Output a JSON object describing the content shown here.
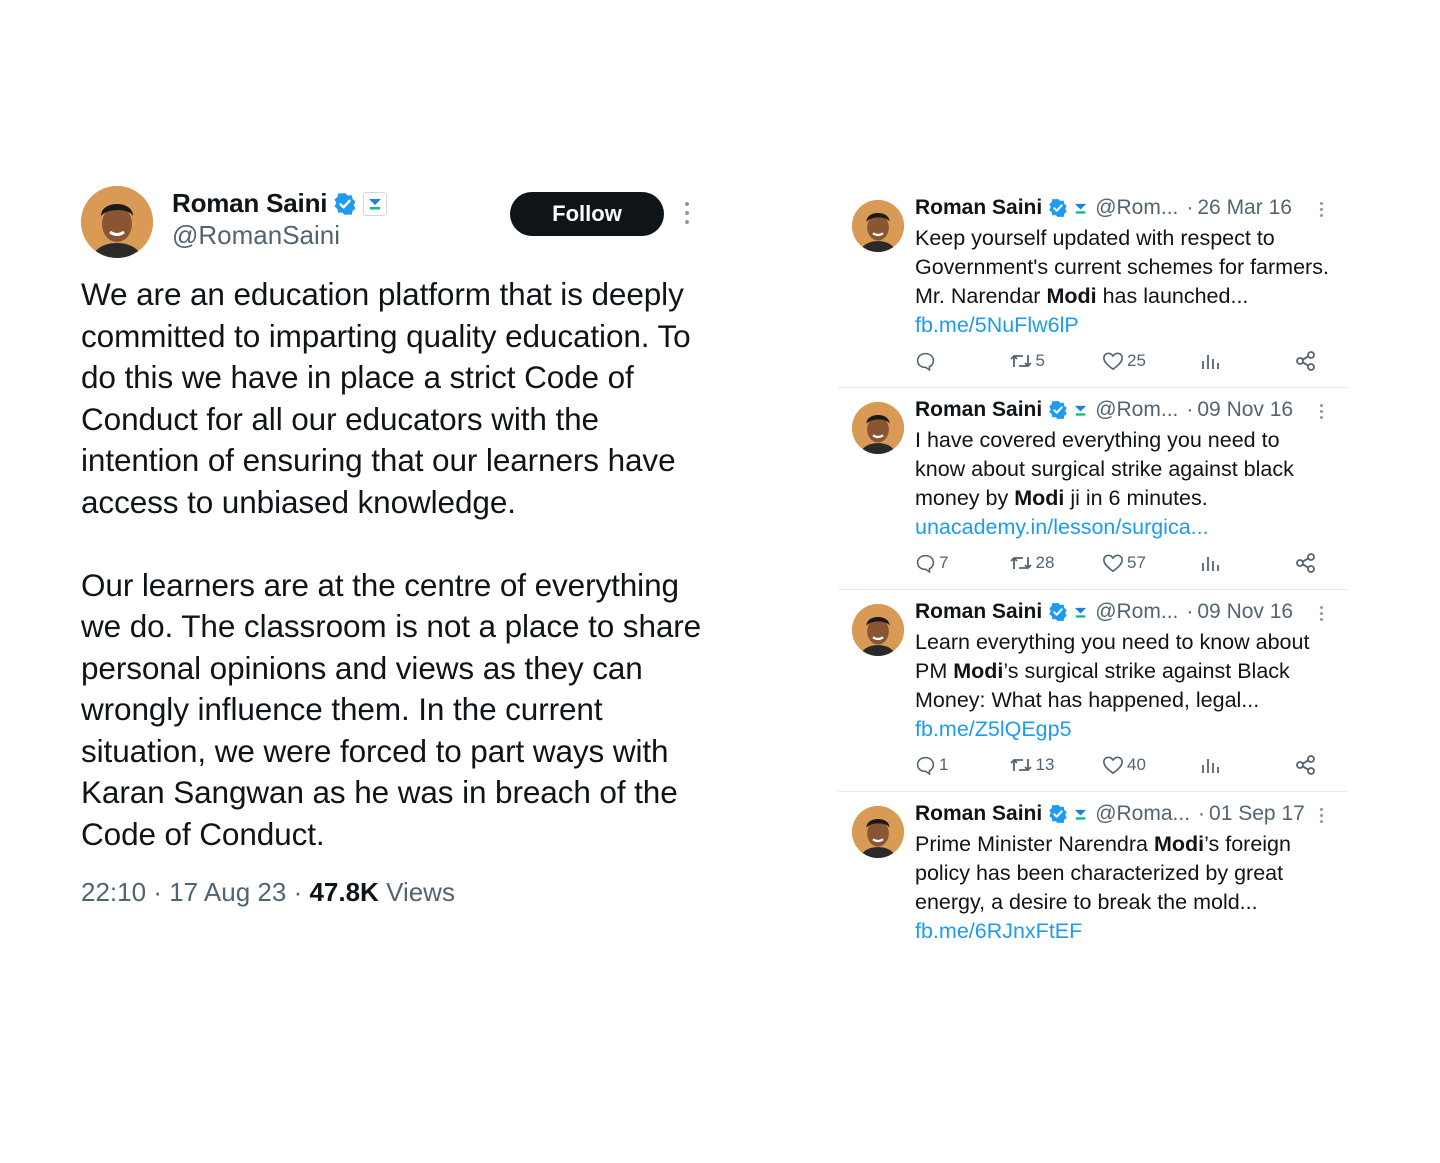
{
  "main_tweet": {
    "author_name": "Roman Saini",
    "handle": "@RomanSaini",
    "follow_label": "Follow",
    "paragraph_1": "We are an education platform that is deeply committed to imparting quality education. To do this we have in place a strict Code of Conduct for all our educators with the intention of ensuring that our learners have access to unbiased knowledge.",
    "paragraph_2": "Our learners are at the centre of everything we do. The classroom is not a place to share personal opinions and views as they can wrongly influence them. In the current situation, we were forced to part ways with Karan Sangwan as he was in breach of the Code of Conduct.",
    "time": "22:10",
    "date": "17 Aug 23",
    "views_count": "47.8K",
    "views_label": "Views"
  },
  "feed": [
    {
      "author_name": "Roman Saini",
      "handle": "@Rom...",
      "date": "26 Mar 16",
      "text_before": "Keep yourself updated with respect to Government's current schemes for farmers. Mr. Narendar ",
      "text_bold": "Modi",
      "text_after": " has launched... ",
      "link": "fb.me/5NuFlw6lP",
      "replies": "",
      "retweets": "5",
      "likes": "25"
    },
    {
      "author_name": "Roman Saini",
      "handle": "@Rom...",
      "date": "09 Nov 16",
      "text_before": "I have covered everything you need to know about surgical strike against black money by ",
      "text_bold": "Modi",
      "text_after": " ji in 6 minutes. ",
      "link": "unacademy.in/lesson/surgica...",
      "replies": "7",
      "retweets": "28",
      "likes": "57"
    },
    {
      "author_name": "Roman Saini",
      "handle": "@Rom...",
      "date": "09 Nov 16",
      "text_before": "Learn everything you need to know about PM ",
      "text_bold": "Modi",
      "text_after": "’s surgical strike against Black Money: What has happened, legal... ",
      "link": "fb.me/Z5lQEgp5",
      "replies": "1",
      "retweets": "13",
      "likes": "40"
    },
    {
      "author_name": "Roman Saini",
      "handle": "@Roma...",
      "date": "01 Sep 17",
      "text_before": "Prime Minister Narendra ",
      "text_bold": "Modi",
      "text_after": "’s foreign policy has been characterized by great energy, a desire to break the mold... ",
      "link": "fb.me/6RJnxFtEF"
    }
  ],
  "colors": {
    "text": "#0f1419",
    "secondary": "#536471",
    "link": "#1d9bf0",
    "verified": "#1d9bf0",
    "follow_bg": "#0f1419"
  },
  "icons": [
    "verified-badge-icon",
    "affiliate-badge-icon",
    "more-options-icon",
    "reply-icon",
    "retweet-icon",
    "like-icon",
    "views-icon",
    "share-icon"
  ]
}
